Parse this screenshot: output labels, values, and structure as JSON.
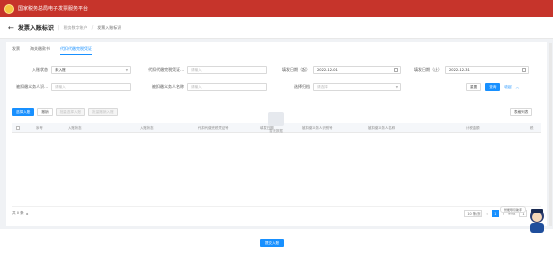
{
  "header": {
    "app_title": "国家税务总局电子发票服务平台",
    "colors": {
      "brand": "#c6342b",
      "accent": "#1890ff"
    }
  },
  "subheader": {
    "page_title": "发票入账标识",
    "crumbs": [
      "税务数字账户",
      "发票入账标识"
    ]
  },
  "tabs": [
    "发票",
    "海关缴款书",
    "代扣代缴完税凭证"
  ],
  "form": {
    "row1": [
      {
        "label": "入账状态",
        "value": "未入账",
        "kind": "select"
      },
      {
        "label": "代扣代缴完税凭证...",
        "placeholder": "请输入",
        "kind": "input"
      },
      {
        "label": "填发日期（起）",
        "value": "2022-12-01",
        "kind": "date"
      },
      {
        "label": "填发日期（止）",
        "value": "2022-12-31",
        "kind": "date"
      }
    ],
    "row2": [
      {
        "label": "被扣缴义务人识...",
        "placeholder": "请输入",
        "kind": "input"
      },
      {
        "label": "被扣缴义务人名称",
        "placeholder": "请输入",
        "kind": "input"
      },
      {
        "label": "选择归档",
        "placeholder": "请选择",
        "kind": "select"
      }
    ],
    "buttons": {
      "reset": "重置",
      "query": "查询",
      "collapse": "收起"
    }
  },
  "toolbar": {
    "entry": "选择入账",
    "cancel": "撤销",
    "batch_entry": "批量选择入账",
    "batch_cancel": "批量撤销入账",
    "columns": "表格列表"
  },
  "table": {
    "columns": [
      "序号",
      "入账状态",
      "入账状态",
      "代扣代缴完税凭证号",
      "填发日期",
      "被扣缴义务人识别号",
      "被扣缴义务人名称",
      "计税金额",
      "税"
    ],
    "empty_text": "暂无数据"
  },
  "pagination": {
    "total": "共 0 条",
    "page_size": "10 条/页",
    "current_page": "1",
    "goto_label": "前往",
    "goto_value": "1",
    "unit": "页"
  },
  "footer": {
    "next_button": "提交入账",
    "assistant_tip": "智能导引助手"
  }
}
